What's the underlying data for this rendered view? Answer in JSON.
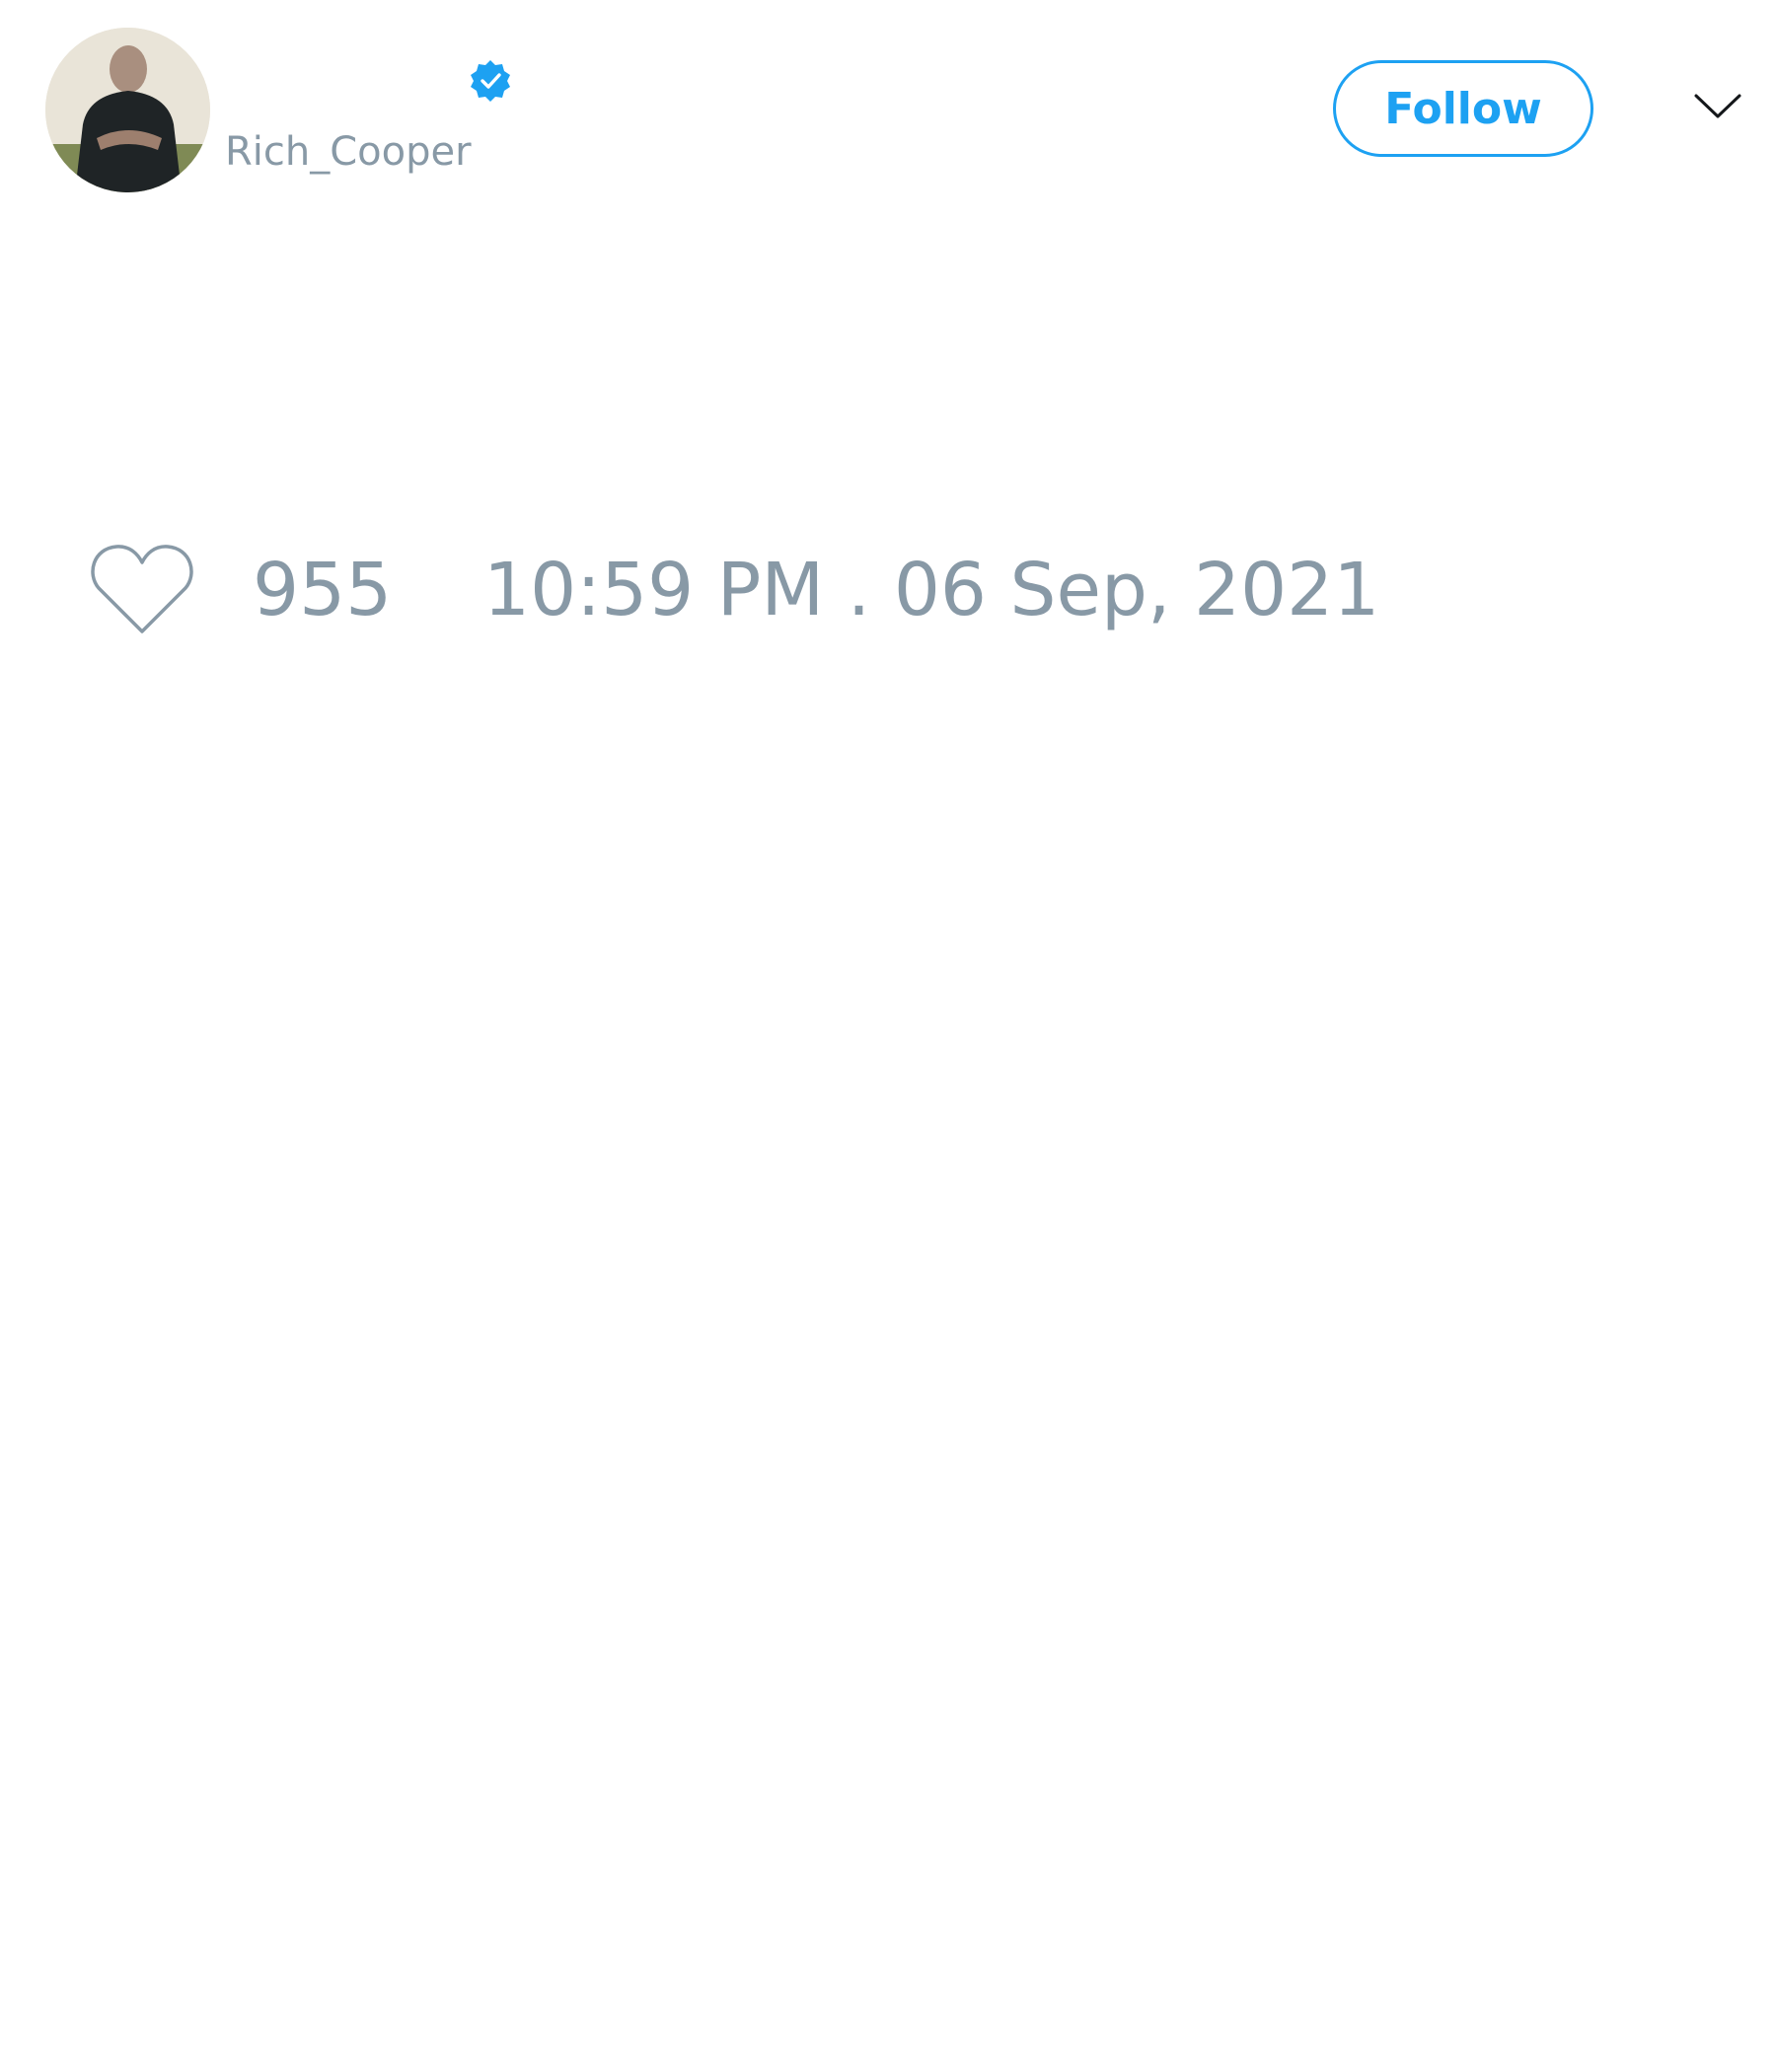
{
  "tweet": {
    "author": {
      "display_name": "",
      "username": "Rich_Cooper",
      "verified": true,
      "avatar": "avatar-photo-man-crossed-arms"
    },
    "follow_label": "Follow",
    "menu_icon": "chevron-down-icon",
    "like_icon": "heart-icon",
    "like_count": "955",
    "timestamp": "10:59 PM . 06 Sep, 2021"
  },
  "colors": {
    "accent": "#1da1f2",
    "muted_text": "#8899a6",
    "background": "#ffffff",
    "icon_dark": "#14171a"
  }
}
